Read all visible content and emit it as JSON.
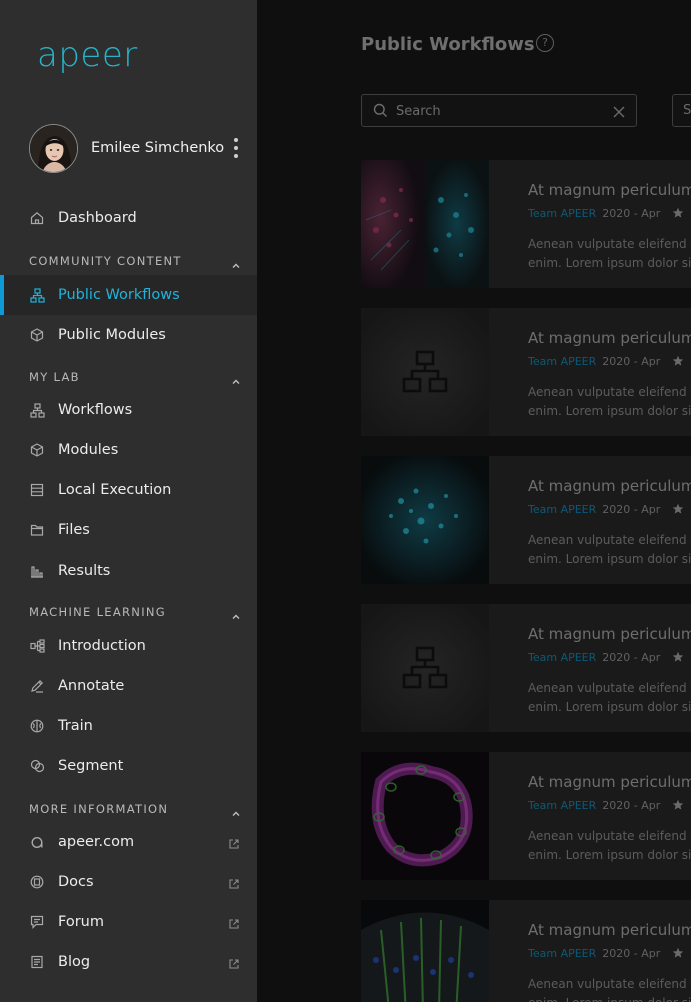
{
  "brand": {
    "logo_text": "apeer",
    "accent": "#25b4c9"
  },
  "user": {
    "name": "Emilee Simchenko"
  },
  "nav": {
    "dashboard": "Dashboard",
    "sections": {
      "community": "COMMUNITY CONTENT",
      "mylab": "MY LAB",
      "ml": "MACHINE LEARNING",
      "more": "MORE INFORMATION"
    },
    "community_items": [
      "Public Workflows",
      "Public Modules"
    ],
    "mylab_items": [
      "Workflows",
      "Modules",
      "Local Execution",
      "Files",
      "Results"
    ],
    "ml_items": [
      "Introduction",
      "Annotate",
      "Train",
      "Segment"
    ],
    "more_items": [
      "apeer.com",
      "Docs",
      "Forum",
      "Blog"
    ],
    "active": "Public Workflows"
  },
  "main": {
    "title": "Public Workflows",
    "help_icon": "?",
    "search_placeholder": "Search",
    "sort_label": "S"
  },
  "cards": [
    {
      "title": "At magnum periculum a",
      "team": "Team APEER",
      "date": "2020 - Apr",
      "desc1": "Aenean vulputate eleifend tel",
      "desc2": "enim. Lorem ipsum dolor sit",
      "thumb": "microscopy-cells"
    },
    {
      "title": "At magnum periculum a",
      "team": "Team APEER",
      "date": "2020 - Apr",
      "desc1": "Aenean vulputate eleifend tel",
      "desc2": "enim. Lorem ipsum dolor sit",
      "thumb": "workflow-placeholder"
    },
    {
      "title": "At magnum periculum a",
      "team": "Team APEER",
      "date": "2020 - Apr",
      "desc1": "Aenean vulputate eleifend tel",
      "desc2": "enim. Lorem ipsum dolor sit",
      "thumb": "microscopy-cyan"
    },
    {
      "title": "At magnum periculum a",
      "team": "Team APEER",
      "date": "2020 - Apr",
      "desc1": "Aenean vulputate eleifend tel",
      "desc2": "enim. Lorem ipsum dolor sit",
      "thumb": "workflow-placeholder"
    },
    {
      "title": "At magnum periculum a",
      "team": "Team APEER",
      "date": "2020 - Apr",
      "desc1": "Aenean vulputate eleifend tel",
      "desc2": "enim. Lorem ipsum dolor sit",
      "thumb": "microscopy-magenta"
    },
    {
      "title": "At magnum periculum a",
      "team": "Team APEER",
      "date": "2020 - Apr",
      "desc1": "Aenean vulputate eleifend tel",
      "desc2": "enim. Lorem ipsum dolor sit",
      "thumb": "microscopy-green"
    }
  ]
}
